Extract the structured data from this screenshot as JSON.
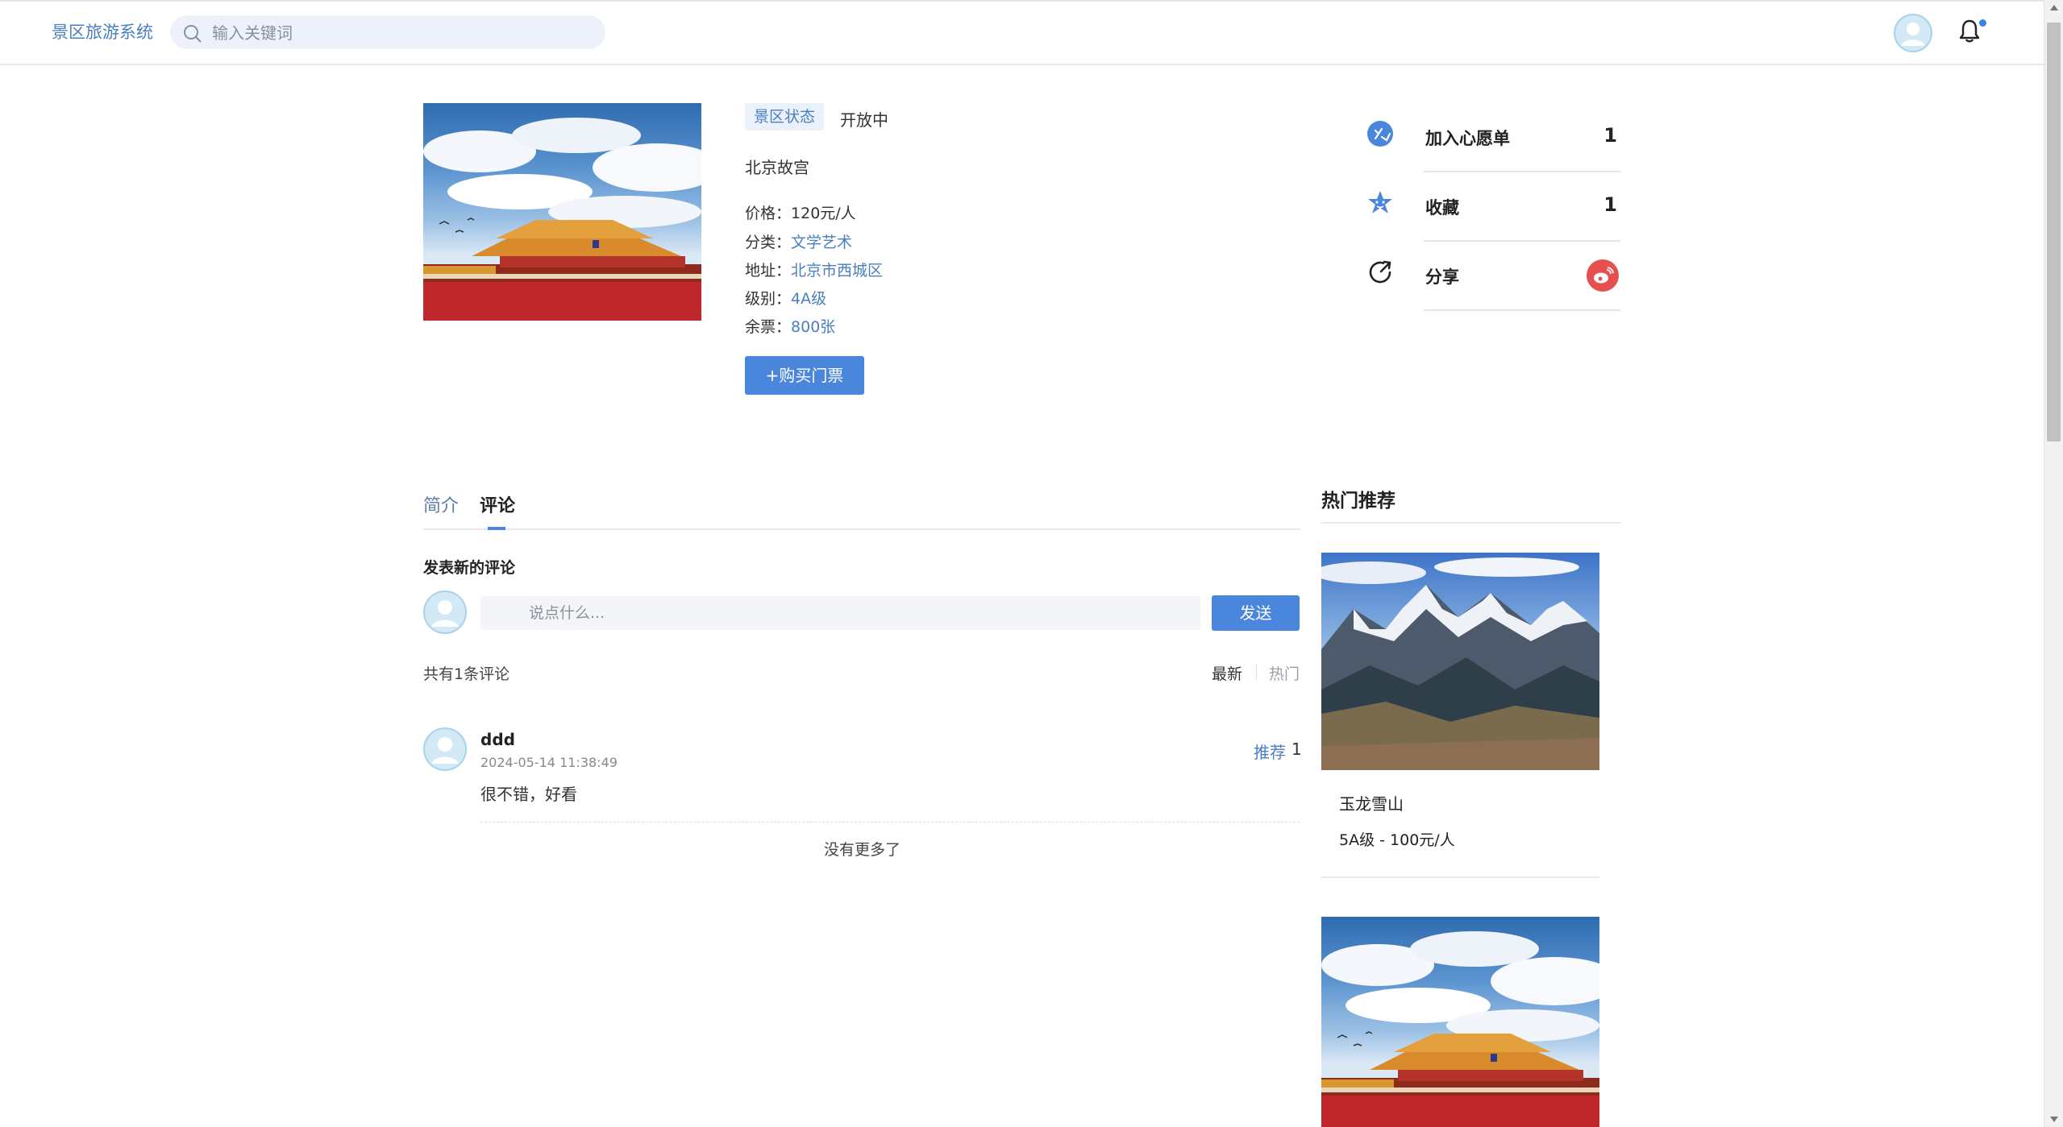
{
  "header": {
    "brand": "景区旅游系统",
    "search_placeholder": "输入关键词"
  },
  "spot": {
    "status_label": "景区状态",
    "status_value": "开放中",
    "name": "北京故宫",
    "price_label": "价格：",
    "price_value": "120元/人",
    "category_label": "分类：",
    "category_value": "文学艺术",
    "address_label": "地址：",
    "address_value": "北京市西城区",
    "level_label": "级别：",
    "level_value": "4A级",
    "tickets_label": "余票：",
    "tickets_value": "800张",
    "buy_button": "+购买门票"
  },
  "side_actions": {
    "wishlist_label": "加入心愿单",
    "wishlist_count": "1",
    "favorite_label": "收藏",
    "favorite_count": "1",
    "share_label": "分享"
  },
  "tabs": {
    "intro": "简介",
    "comments": "评论"
  },
  "comments": {
    "new_title": "发表新的评论",
    "input_placeholder": "说点什么...",
    "send_button": "发送",
    "total_text": "共有1条评论",
    "sort_latest": "最新",
    "sort_hot": "热门",
    "items": [
      {
        "user": "ddd",
        "time": "2024-05-14 11:38:49",
        "text": "很不错，好看",
        "recommend_label": "推荐",
        "recommend_count": "1"
      }
    ],
    "no_more": "没有更多了"
  },
  "hot": {
    "title": "热门推荐",
    "items": [
      {
        "name": "玉龙雪山",
        "meta": "5A级 - 100元/人"
      }
    ]
  },
  "colors": {
    "accent": "#4a86dc",
    "link": "#4a7fbf",
    "weibo": "#e6504f"
  }
}
